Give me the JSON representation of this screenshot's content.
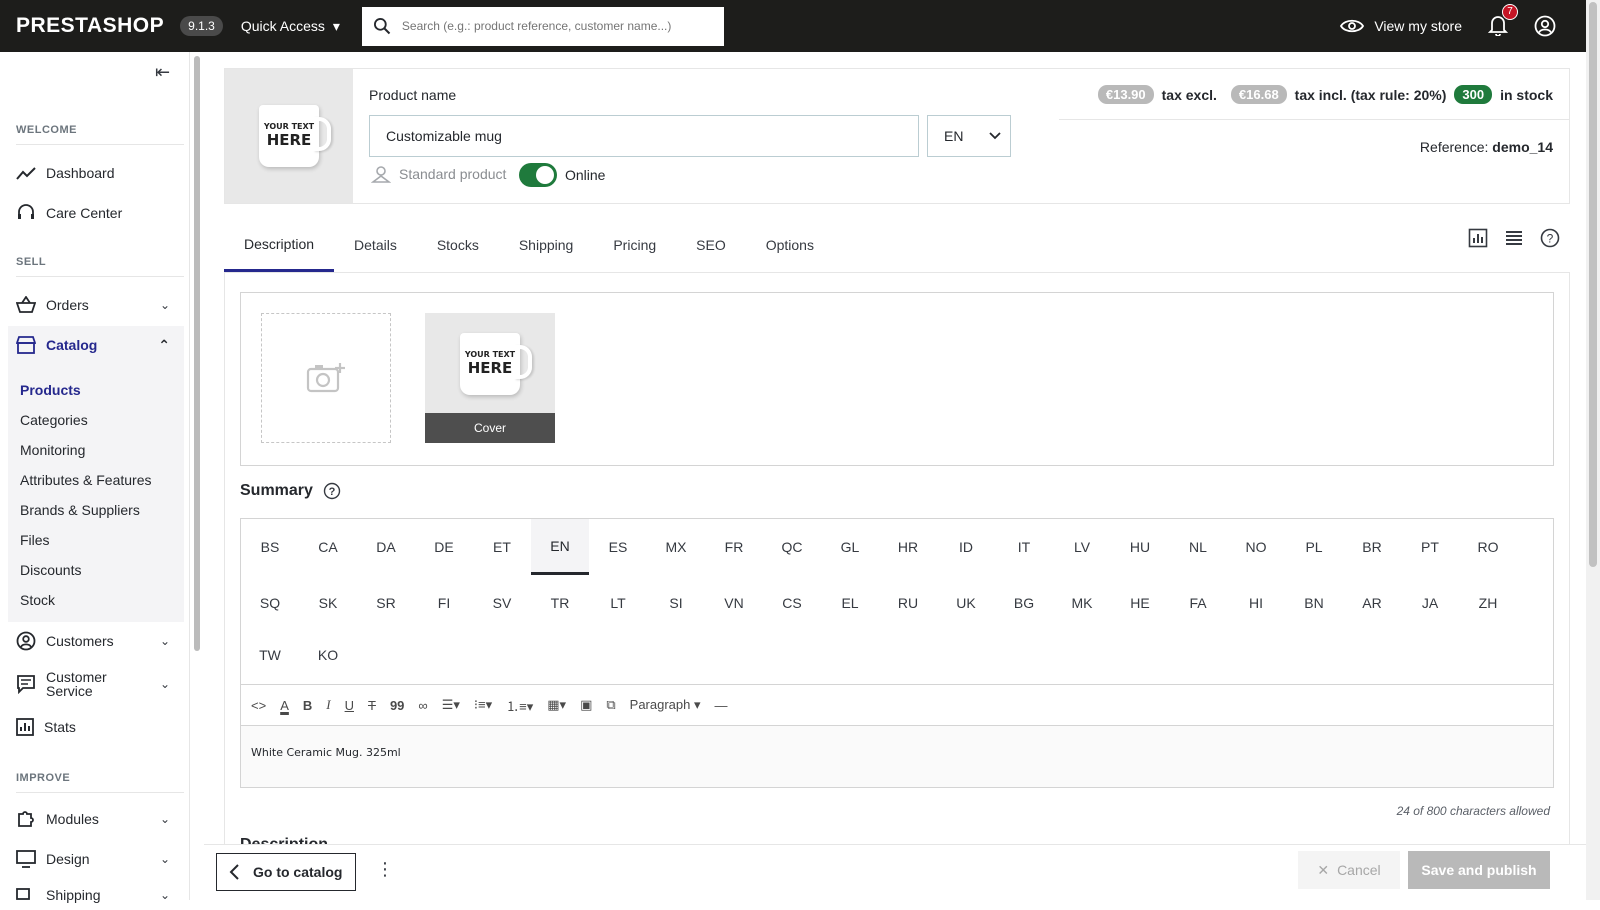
{
  "topbar": {
    "logo": "PRESTASHOP",
    "version": "9.1.3",
    "quick_access": "Quick Access",
    "search_placeholder": "Search (e.g.: product reference, customer name...)",
    "view_store": "View my store",
    "notifications_count": "7"
  },
  "sidebar": {
    "sections": {
      "welcome": "WELCOME",
      "sell": "SELL",
      "improve": "IMPROVE"
    },
    "dashboard": "Dashboard",
    "care_center": "Care Center",
    "orders": "Orders",
    "catalog": "Catalog",
    "catalog_items": [
      "Products",
      "Categories",
      "Monitoring",
      "Attributes & Features",
      "Brands & Suppliers",
      "Files",
      "Discounts",
      "Stock"
    ],
    "customers": "Customers",
    "customer_service": "Customer Service",
    "stats": "Stats",
    "modules": "Modules",
    "design": "Design",
    "shipping": "Shipping"
  },
  "product": {
    "name_label": "Product name",
    "name_value": "Customizable mug",
    "language": "EN",
    "type": "Standard product",
    "online_label": "Online",
    "online": true,
    "price_excl": "€13.90",
    "tax_excl_label": "tax excl.",
    "price_incl": "€16.68",
    "tax_incl_label": "tax incl. (tax rule: 20%)",
    "stock": "300",
    "stock_label": "in stock",
    "reference_label": "Reference:",
    "reference": "demo_14",
    "mug_text_small": "YOUR TEXT",
    "mug_text_big": "HERE"
  },
  "tabs": [
    "Description",
    "Details",
    "Stocks",
    "Shipping",
    "Pricing",
    "SEO",
    "Options"
  ],
  "images": {
    "cover_label": "Cover"
  },
  "summary": {
    "title": "Summary",
    "languages_row1": [
      "BS",
      "CA",
      "DA",
      "DE",
      "ET",
      "EN",
      "ES",
      "MX",
      "FR",
      "QC",
      "GL",
      "HR",
      "ID",
      "IT",
      "LV",
      "HU",
      "NL",
      "NO",
      "PL",
      "BR",
      "PT",
      "RO"
    ],
    "languages_row2": [
      "SQ",
      "SK",
      "SR",
      "FI",
      "SV",
      "TR",
      "LT",
      "SI",
      "VN",
      "CS",
      "EL",
      "RU",
      "UK",
      "BG",
      "MK",
      "HE",
      "FA",
      "HI",
      "BN",
      "AR",
      "JA",
      "ZH"
    ],
    "languages_row3": [
      "TW",
      "KO"
    ],
    "active_language": "EN",
    "paragraph_label": "Paragraph",
    "content": "White Ceramic Mug. 325ml",
    "char_count": "24 of 800 characters allowed"
  },
  "description_title": "Description",
  "footer": {
    "go_to_catalog": "Go to catalog",
    "cancel": "Cancel",
    "save": "Save and publish"
  },
  "colors": {
    "topbar": "#1d1d1b",
    "accent": "#25288d",
    "online_green": "#1f7a3c"
  }
}
